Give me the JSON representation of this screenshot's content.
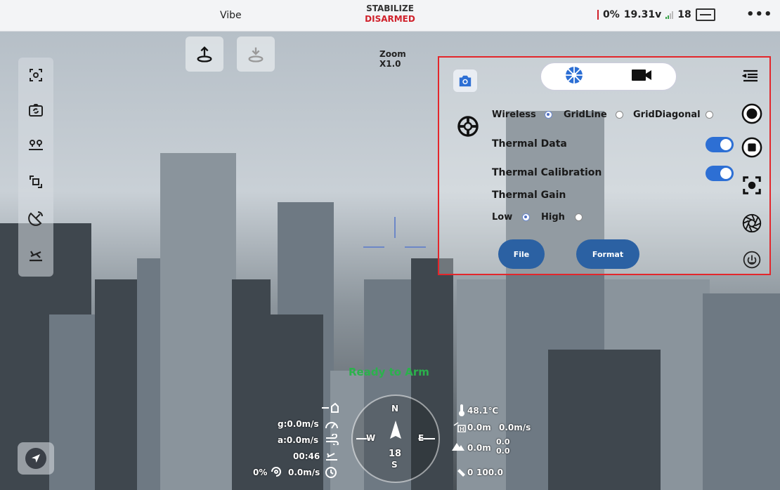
{
  "topbar": {
    "app_name": "Vibe",
    "flight_mode": "STABILIZE",
    "arm_state": "DISARMED",
    "battery_percent": "0%",
    "voltage": "19.31v",
    "satellites": "18",
    "more": "•••"
  },
  "zoom": {
    "label": "Zoom",
    "value": "X1.0"
  },
  "camera_panel": {
    "wireless_label": "Wireless",
    "gridline_label": "GridLine",
    "griddiagonal_label": "GridDiagonal",
    "thermal_data_label": "Thermal Data",
    "thermal_calibration_label": "Thermal Calibration",
    "thermal_gain_label": "Thermal Gain",
    "gain_low_label": "Low",
    "gain_high_label": "High",
    "file_button": "File",
    "format_button": "Format",
    "selected_grid": "Wireless",
    "selected_gain": "Low",
    "thermal_data_on": true,
    "thermal_calibration_on": true
  },
  "status_message": "Ready to Arm",
  "telemetry": {
    "ground_speed": "g:0.0m/s",
    "air_speed": "a:0.0m/s",
    "flight_time": "00:46",
    "throttle": "0%",
    "climb_rate": "0.0m/s",
    "temperature": "48.1℃",
    "home_distance": "0.0m",
    "home_speed": "0.0m/s",
    "altitude": "0.0m",
    "alt_top": "0.0",
    "alt_bottom": "0.0",
    "signal_rssi": "0",
    "signal_quality": "100.0",
    "heading": "18",
    "compass_n": "N",
    "compass_s": "S",
    "compass_w": "W",
    "compass_e": "E"
  },
  "colors": {
    "accent": "#2d6fd4",
    "danger": "#d0212b",
    "ok": "#2bb24c",
    "highlight_border": "#e3262b"
  },
  "icons": [
    "gimbal-center-icon",
    "camera-switch-icon",
    "waypoint-icon",
    "crop-icon",
    "satellite-dish-icon",
    "takeoff-plane-icon",
    "send-icon",
    "takeoff-icon",
    "landing-icon",
    "camera-icon",
    "aperture-icon",
    "video-icon",
    "collapse-menu-icon",
    "record-icon",
    "stop-icon",
    "focus-icon",
    "gimbal-wheel-icon",
    "power-icon"
  ]
}
